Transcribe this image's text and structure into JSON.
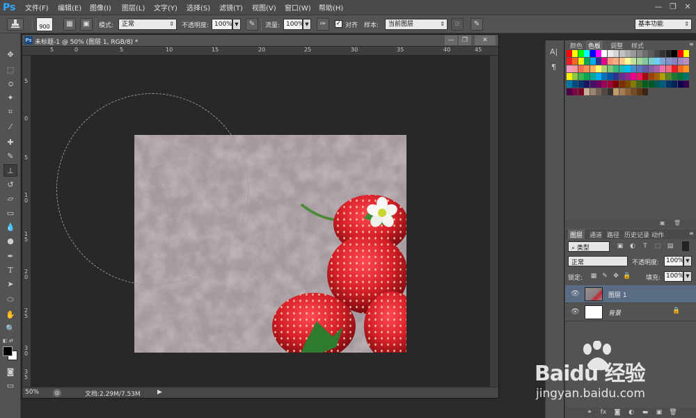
{
  "app": {
    "logo": "Ps"
  },
  "menu": [
    "文件(F)",
    "编辑(E)",
    "图像(I)",
    "图层(L)",
    "文字(Y)",
    "选择(S)",
    "滤镜(T)",
    "视图(V)",
    "窗口(W)",
    "帮助(H)"
  ],
  "window_controls": {
    "minimize": "—",
    "restore": "❐",
    "close": "✕"
  },
  "options": {
    "brush_size": "900",
    "mode_label": "模式:",
    "mode_value": "正常",
    "opacity_label": "不透明度:",
    "opacity_value": "100%",
    "flow_label": "流量:",
    "flow_value": "100%",
    "align_label": "对齐",
    "sample_label": "样本:",
    "sample_value": "当前图层",
    "workspace": "基本功能"
  },
  "document": {
    "tab_title": "未标题-1 @ 50% (图层 1, RGB/8) *",
    "ruler_top": [
      "5",
      "0",
      "5",
      "10",
      "15",
      "20",
      "25",
      "30",
      "35",
      "40",
      "45"
    ],
    "ruler_left": [
      "5",
      "0",
      "5",
      "1",
      "0",
      "1",
      "5",
      "2",
      "0",
      "2",
      "5",
      "3",
      "0",
      "3",
      "5"
    ],
    "zoom": "50%",
    "doc_info": "文档:2.29M/7.53M"
  },
  "panels": {
    "top_tabs": [
      "颜色",
      "色板",
      "调整",
      "样式"
    ],
    "layers_tabs": [
      "图层",
      "通道",
      "路径",
      "历史记录",
      "动作"
    ],
    "filter_kind": "类型",
    "blend_mode": "正常",
    "opacity_label": "不透明度:",
    "opacity_value": "100%",
    "lock_label": "锁定:",
    "fill_label": "填充:",
    "fill_value": "100%",
    "layers": [
      {
        "name": "图层 1"
      },
      {
        "name": "背景"
      }
    ]
  },
  "watermark": {
    "brand": "Baidu 经验",
    "url": "jingyan.baidu.com"
  },
  "colors": {
    "swatch_rows": [
      [
        "#ff0000",
        "#ffff00",
        "#00ff00",
        "#00ffff",
        "#0000ff",
        "#ff00ff",
        "#ffffff",
        "#ebebeb",
        "#d6d6d6",
        "#c2c2c2",
        "#adadad",
        "#999999",
        "#858585",
        "#707070",
        "#5c5c5c",
        "#474747",
        "#333333",
        "#1f1f1f",
        "#000000",
        "#ff0000",
        "#ffff00"
      ],
      [
        "#ed1c24",
        "#f26522",
        "#fff200",
        "#00a651",
        "#00aeef",
        "#2e3192",
        "#ec008c",
        "#f7977a",
        "#f9ad81",
        "#fdc68a",
        "#fff79a",
        "#c4df9b",
        "#a3d39c",
        "#82ca9d",
        "#7bcdc8",
        "#6ecff6",
        "#7ea7d8",
        "#8493ca",
        "#8882be",
        "#a187be",
        "#bc8dbf"
      ],
      [
        "#f49ac2",
        "#f6989d",
        "#f26c4f",
        "#f68e55",
        "#fbaf5c",
        "#fff467",
        "#acd372",
        "#7cc576",
        "#3bb878",
        "#1abbb4",
        "#00bff3",
        "#438cca",
        "#5574b9",
        "#605ca8",
        "#855fa8",
        "#a763a8",
        "#f06ea9",
        "#f26d7d",
        "#ed1c24",
        "#f26522",
        "#f7941d"
      ],
      [
        "#fff200",
        "#8dc63f",
        "#39b54a",
        "#00a651",
        "#00a99d",
        "#00aeef",
        "#0072bc",
        "#0054a6",
        "#2e3192",
        "#662d91",
        "#92278f",
        "#ec008c",
        "#ed145b",
        "#9e0b0f",
        "#a0410d",
        "#a36209",
        "#aba000",
        "#598527",
        "#1a7b30",
        "#007236",
        "#00746b"
      ],
      [
        "#0076a3",
        "#004b80",
        "#003471",
        "#1b1464",
        "#440e62",
        "#630460",
        "#9e005d",
        "#9e0039",
        "#790000",
        "#7b2e00",
        "#7d4900",
        "#827b00",
        "#406618",
        "#005e20",
        "#005826",
        "#005952",
        "#005b7f",
        "#003663",
        "#002157",
        "#0d004c",
        "#32004b"
      ],
      [
        "#4b0049",
        "#7b0046",
        "#7a0026",
        "#c7b299",
        "#998675",
        "#736357",
        "#534741",
        "#37302d",
        "#c69c6d",
        "#a67c52",
        "#8c6239",
        "#754c24",
        "#603913",
        "#3c2415"
      ]
    ],
    "accent": "#31a8ff",
    "selected_layer_bg": "#5a6b84"
  }
}
